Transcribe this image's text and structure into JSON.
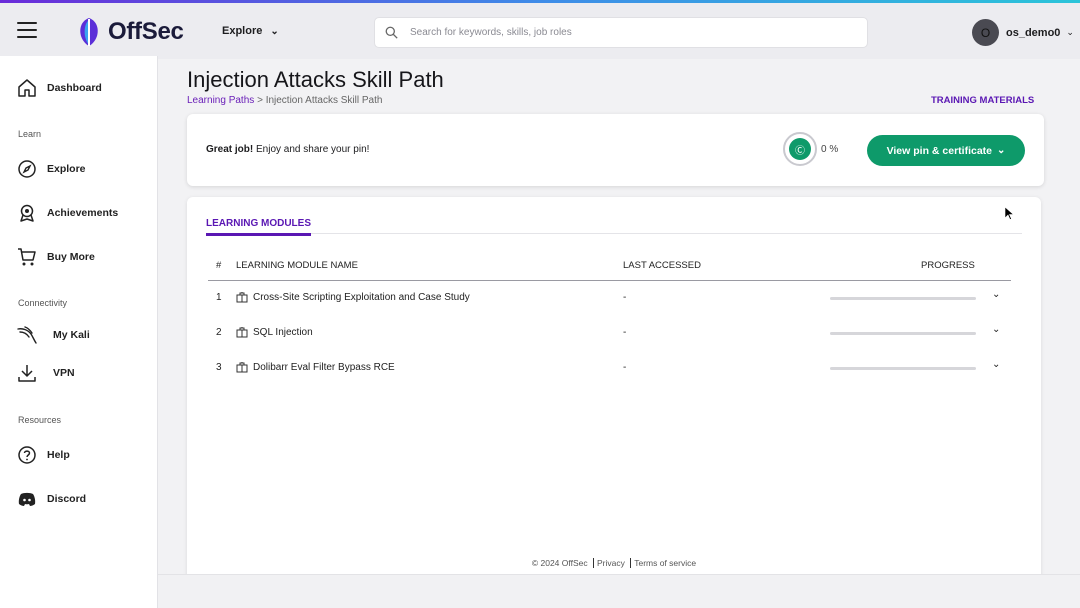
{
  "header": {
    "brand": "OffSec",
    "explore_label": "Explore",
    "search_placeholder": "Search for keywords, skills, job roles",
    "username": "os_demo0",
    "avatar_initial": "O"
  },
  "sidebar": {
    "dashboard": "Dashboard",
    "sections": {
      "learn": "Learn",
      "connectivity": "Connectivity",
      "resources": "Resources"
    },
    "explore": "Explore",
    "achievements": "Achievements",
    "buy_more": "Buy More",
    "my_kali": "My Kali",
    "vpn": "VPN",
    "help": "Help",
    "discord": "Discord"
  },
  "page": {
    "title": "Injection Attacks Skill Path",
    "breadcrumb_root": "Learning Paths",
    "breadcrumb_sep": ">",
    "breadcrumb_current": "Injection Attacks Skill Path",
    "training_materials": "TRAINING MATERIALS"
  },
  "pin": {
    "message_bold": "Great job!",
    "message_rest": " Enjoy and share your pin!",
    "progress_text": "0 %",
    "progress": 0,
    "button_label": "View pin & certificate"
  },
  "modules": {
    "tab": "LEARNING MODULES",
    "columns": {
      "num": "#",
      "name": "LEARNING MODULE NAME",
      "accessed": "LAST ACCESSED",
      "progress": "PROGRESS"
    },
    "rows": [
      {
        "num": "1",
        "name": "Cross-Site Scripting Exploitation and Case Study",
        "accessed": "-",
        "progress": 0
      },
      {
        "num": "2",
        "name": "SQL Injection",
        "accessed": "-",
        "progress": 0
      },
      {
        "num": "3",
        "name": "Dolibarr Eval Filter Bypass RCE",
        "accessed": "-",
        "progress": 0
      }
    ]
  },
  "footer": {
    "copyright": "© 2024  OffSec",
    "privacy": "Privacy",
    "terms": "Terms of service"
  },
  "colors": {
    "accent_purple": "#5a17b3",
    "accent_green": "#0e9a6a"
  }
}
